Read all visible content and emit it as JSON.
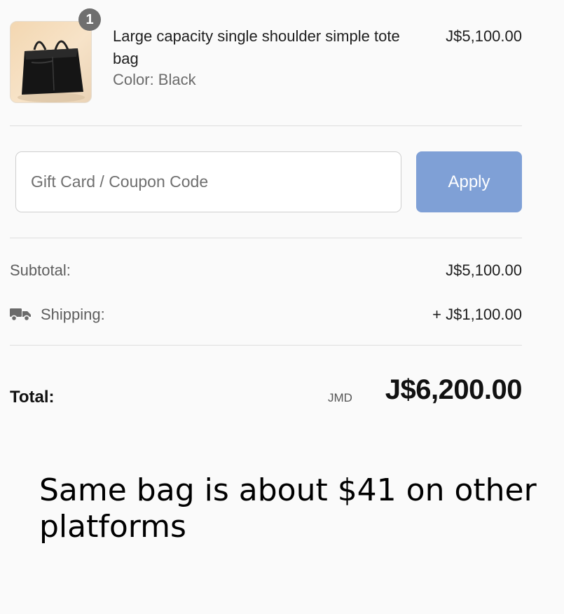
{
  "cart_item": {
    "quantity": "1",
    "name": "Large capacity single shoulder simple tote bag",
    "variant": "Color: Black",
    "price": "J$5,100.00",
    "thumbnail_icon": "tote-bag-image"
  },
  "coupon": {
    "placeholder": "Gift Card / Coupon Code",
    "value": "",
    "apply_label": "Apply"
  },
  "summary": {
    "subtotal_label": "Subtotal:",
    "subtotal_value": "J$5,100.00",
    "shipping_icon": "truck-icon",
    "shipping_label": "Shipping:",
    "shipping_value": "+ J$1,100.00",
    "total_label": "Total:",
    "currency_code": "JMD",
    "total_value": "J$6,200.00"
  },
  "caption": "Same bag is about $41 on other platforms",
  "colors": {
    "background": "#fafafa",
    "apply_button": "#7fa0d6",
    "badge": "#6f6f6f",
    "divider": "#dedede"
  }
}
